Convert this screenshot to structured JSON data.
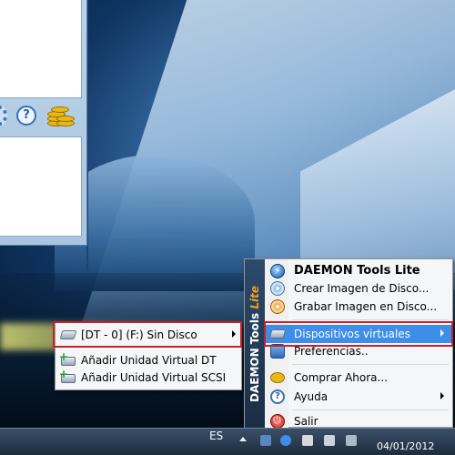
{
  "main_menu": {
    "brand_vertical": "DAEMON Tools",
    "brand_lite": "Lite",
    "items": [
      {
        "label": "DAEMON Tools Lite",
        "icon": "daemon-tools-icon"
      },
      {
        "label": "Crear Imagen de Disco...",
        "icon": "disc-image-icon"
      },
      {
        "label": "Grabar Imagen en Disco...",
        "icon": "burn-disc-icon"
      },
      {
        "label": "Dispositivos virtuales",
        "icon": "virtual-drive-icon",
        "has_submenu": true,
        "highlighted": true
      },
      {
        "label": "Preferencias..",
        "icon": "preferences-icon"
      },
      {
        "label": "Comprar Ahora...",
        "icon": "coins-icon"
      },
      {
        "label": "Ayuda",
        "icon": "help-icon",
        "has_submenu": true
      },
      {
        "label": "Salir",
        "icon": "exit-icon"
      }
    ]
  },
  "sub_menu": {
    "items": [
      {
        "label": "[DT - 0] (F:) Sin Disco",
        "icon": "virtual-drive-icon",
        "has_submenu": true
      },
      {
        "label": "Añadir Unidad Virtual DT",
        "icon": "add-drive-icon"
      },
      {
        "label": "Añadir Unidad Virtual SCSI",
        "icon": "add-drive-icon"
      }
    ]
  },
  "app_window": {
    "help_glyph": "?"
  },
  "taskbar": {
    "language": "ES",
    "date": "04/01/2012"
  },
  "colors": {
    "highlight": "#3c8ee8",
    "annotation_box": "#c8202a",
    "brand_accent": "#f0a020"
  }
}
